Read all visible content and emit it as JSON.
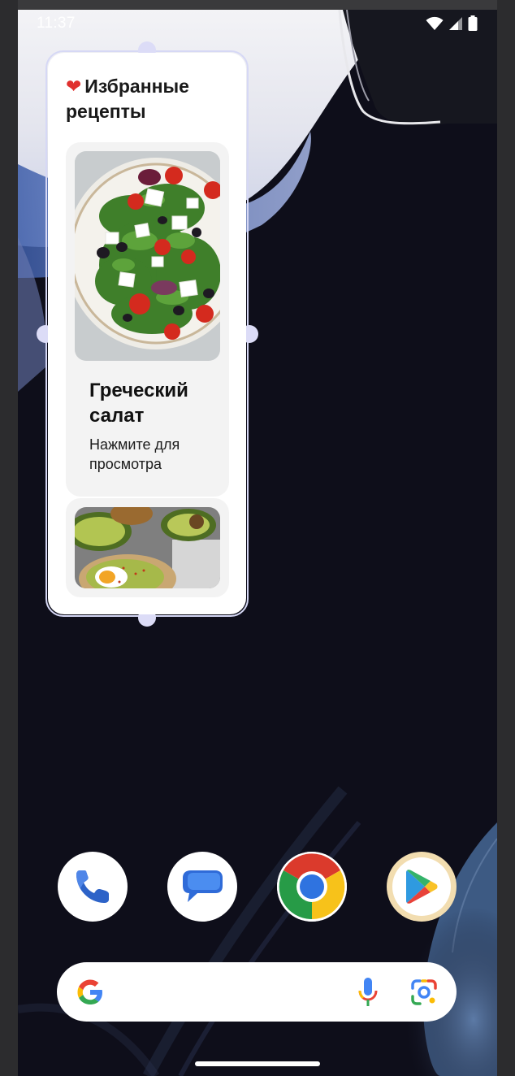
{
  "status_bar": {
    "time": "11:37",
    "icons": [
      "wifi-icon",
      "cell-signal-icon",
      "battery-icon"
    ]
  },
  "widget": {
    "title": "Избранные рецепты",
    "heart_icon": "heart-icon",
    "cards": [
      {
        "title": "Греческий салат",
        "subtitle": "Нажмите для просмотра",
        "image": "greek-salad-photo"
      },
      {
        "title": "",
        "subtitle": "",
        "image": "avocado-toast-photo"
      }
    ]
  },
  "dock": {
    "apps": [
      "phone-app",
      "messages-app",
      "chrome-app",
      "play-store-app"
    ]
  },
  "search_bar": {
    "logo": "google-logo-icon",
    "icons": [
      "microphone-icon",
      "google-lens-icon"
    ]
  },
  "colors": {
    "accent_handles": "#dcdcf7",
    "widget_border": "#d6d8f5",
    "card_bg": "#f3f3f3"
  }
}
